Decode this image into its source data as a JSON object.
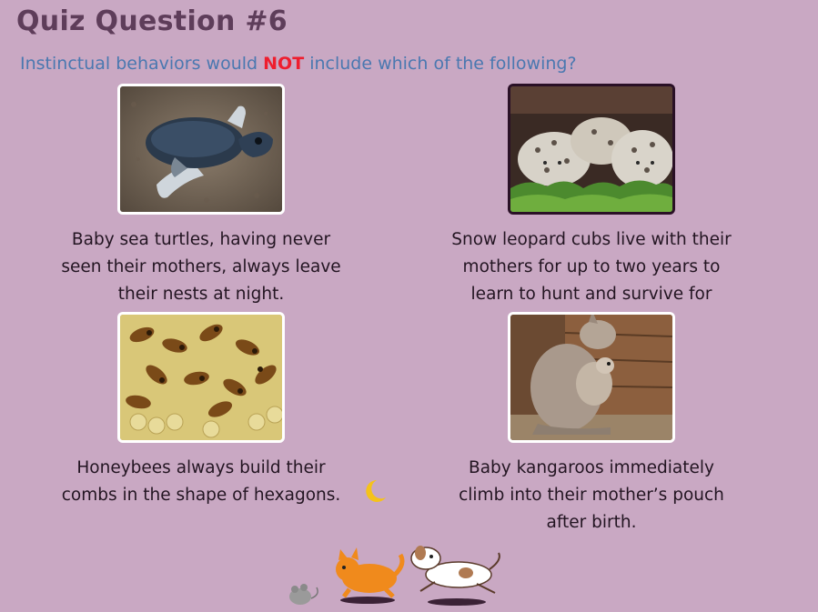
{
  "title": "Quiz Question #6",
  "question": {
    "before": "Instinctual behaviors would ",
    "emphasis": "NOT",
    "after": " include which of the following?"
  },
  "options": [
    {
      "caption": "Baby sea turtles, having never seen their mothers, always leave their nests at night.",
      "image": "sea-turtle-hatchling-photo",
      "selected": false
    },
    {
      "caption": "Snow leopard cubs live with their mothers for up to two years to learn to hunt and survive for themselves.",
      "image": "snow-leopard-cubs-photo",
      "selected": true
    },
    {
      "caption": "Honeybees always build their combs in the shape of hexagons.",
      "image": "honeybees-on-comb-photo",
      "selected": false
    },
    {
      "caption": "Baby kangaroos immediately climb into their mother’s pouch after birth.",
      "image": "kangaroo-with-joey-photo",
      "selected": false
    }
  ],
  "decorations": {
    "moon": "crescent-moon-icon",
    "animals": [
      "mouse-icon",
      "cat-icon",
      "dog-icon"
    ]
  },
  "colors": {
    "background": "#c9a8c3",
    "title": "#5e3d5a",
    "question": "#4a78b0",
    "emphasis": "#ee1e2e",
    "selected_border": "#2a1026"
  }
}
